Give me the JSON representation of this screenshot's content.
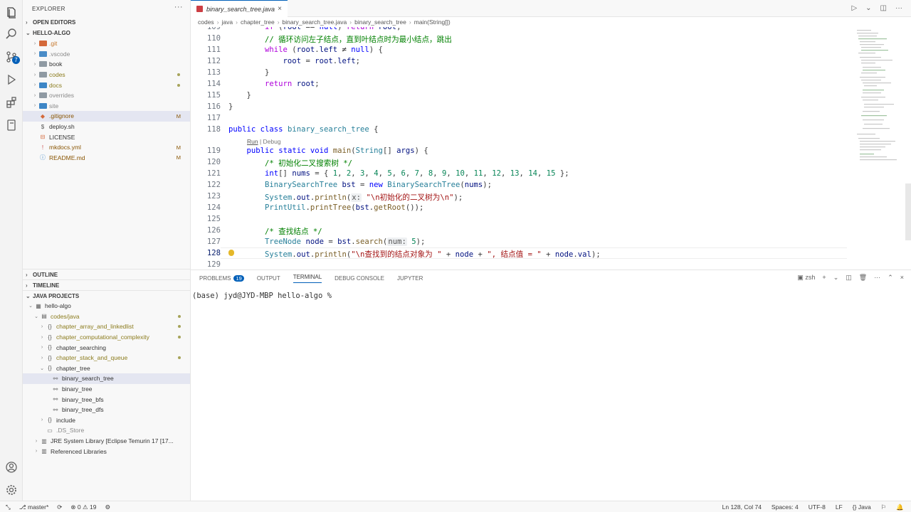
{
  "activity": {
    "scm_badge": "7"
  },
  "explorer": {
    "title": "EXPLORER",
    "open_editors": "OPEN EDITORS",
    "workspace": "HELLO-ALGO",
    "items": [
      {
        "label": ".git",
        "color": "#c5772b",
        "flag": ""
      },
      {
        "label": ".vscode",
        "color": "#8a8a8a",
        "flag": ""
      },
      {
        "label": "book",
        "color": "#333333",
        "flag": ""
      },
      {
        "label": "codes",
        "color": "#8b7b1c",
        "flag": "dot"
      },
      {
        "label": "docs",
        "color": "#8b7b1c",
        "flag": "dot"
      },
      {
        "label": "overrides",
        "color": "#8a8a8a",
        "flag": ""
      },
      {
        "label": "site",
        "color": "#8a8a8a",
        "flag": ""
      },
      {
        "label": ".gitignore",
        "color": "#895503",
        "flag": "M"
      },
      {
        "label": "deploy.sh",
        "color": "#333333",
        "flag": ""
      },
      {
        "label": "LICENSE",
        "color": "#333333",
        "flag": ""
      },
      {
        "label": "mkdocs.yml",
        "color": "#895503",
        "flag": "M"
      },
      {
        "label": "README.md",
        "color": "#895503",
        "flag": "M"
      }
    ],
    "outline": "OUTLINE",
    "timeline": "TIMELINE",
    "java_projects": "JAVA PROJECTS",
    "project_items": [
      {
        "label": "hello-algo",
        "indent": 1,
        "color": "#333333",
        "flag": ""
      },
      {
        "label": "codes/java",
        "indent": 2,
        "color": "#8b7b1c",
        "flag": "dot"
      },
      {
        "label": "chapter_array_and_linkedlist",
        "indent": 3,
        "color": "#8b7b1c",
        "flag": "dot"
      },
      {
        "label": "chapter_computational_complexity",
        "indent": 3,
        "color": "#8b7b1c",
        "flag": "dot"
      },
      {
        "label": "chapter_searching",
        "indent": 3,
        "color": "#333333",
        "flag": ""
      },
      {
        "label": "chapter_stack_and_queue",
        "indent": 3,
        "color": "#8b7b1c",
        "flag": "dot"
      },
      {
        "label": "chapter_tree",
        "indent": 3,
        "color": "#333333",
        "flag": ""
      },
      {
        "label": "binary_search_tree",
        "indent": 4,
        "color": "#333333",
        "flag": ""
      },
      {
        "label": "binary_tree",
        "indent": 4,
        "color": "#333333",
        "flag": ""
      },
      {
        "label": "binary_tree_bfs",
        "indent": 4,
        "color": "#333333",
        "flag": ""
      },
      {
        "label": "binary_tree_dfs",
        "indent": 4,
        "color": "#333333",
        "flag": ""
      },
      {
        "label": "include",
        "indent": 3,
        "color": "#333333",
        "flag": ""
      },
      {
        "label": ".DS_Store",
        "indent": 3,
        "color": "#8a8a8a",
        "flag": ""
      },
      {
        "label": "JRE System Library [Eclipse Temurin 17 [17...",
        "indent": 2,
        "color": "#333333",
        "flag": ""
      },
      {
        "label": "Referenced Libraries",
        "indent": 2,
        "color": "#333333",
        "flag": ""
      }
    ]
  },
  "editor": {
    "tab_label": "binary_search_tree.java",
    "breadcrumb": [
      "codes",
      "java",
      "chapter_tree",
      "binary_search_tree.java",
      "binary_search_tree",
      "main(String[])"
    ],
    "codelens": {
      "run": "Run",
      "debug": "Debug"
    }
  },
  "panel": {
    "tabs": [
      "PROBLEMS",
      "OUTPUT",
      "TERMINAL",
      "DEBUG CONSOLE",
      "JUPYTER"
    ],
    "problems_count": "19",
    "shell": "zsh",
    "prompt": "(base) jyd@JYD-MBP hello-algo %"
  },
  "status": {
    "branch": "master*",
    "errors": "0",
    "warnings": "19",
    "cursor": "Ln 128, Col 74",
    "spaces": "Spaces: 4",
    "encoding": "UTF-8",
    "eol": "LF",
    "language": "Java"
  }
}
